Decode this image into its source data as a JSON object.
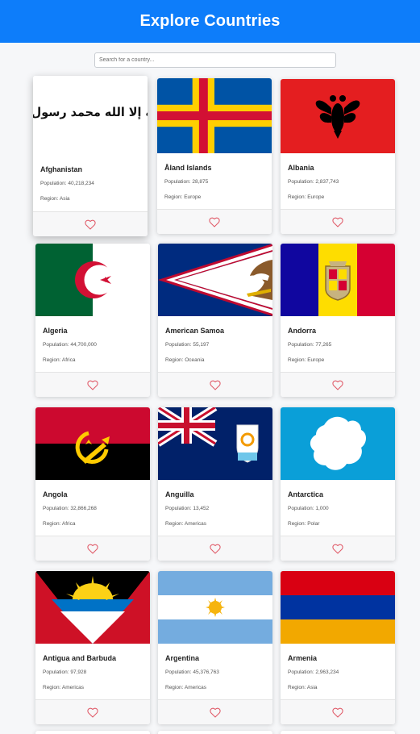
{
  "header": {
    "title": "Explore Countries"
  },
  "search": {
    "placeholder": "Search for a country...",
    "value": ""
  },
  "labels": {
    "population": "Population: ",
    "region": "Region: "
  },
  "colors": {
    "header": "#0d7dfa",
    "heart": "#e05a68"
  },
  "countries": [
    {
      "name": "Afghanistan",
      "population": "40,218,234",
      "region": "Asia",
      "flag_icon": "afghanistan-flag",
      "flag_inscription": "لا إله إلا الله محمد رسول الله"
    },
    {
      "name": "Åland Islands",
      "population": "28,875",
      "region": "Europe",
      "flag_icon": "aland-islands-flag"
    },
    {
      "name": "Albania",
      "population": "2,837,743",
      "region": "Europe",
      "flag_icon": "albania-flag"
    },
    {
      "name": "Algeria",
      "population": "44,700,000",
      "region": "Africa",
      "flag_icon": "algeria-flag"
    },
    {
      "name": "American Samoa",
      "population": "55,197",
      "region": "Oceania",
      "flag_icon": "american-samoa-flag"
    },
    {
      "name": "Andorra",
      "population": "77,265",
      "region": "Europe",
      "flag_icon": "andorra-flag"
    },
    {
      "name": "Angola",
      "population": "32,866,268",
      "region": "Africa",
      "flag_icon": "angola-flag"
    },
    {
      "name": "Anguilla",
      "population": "13,452",
      "region": "Americas",
      "flag_icon": "anguilla-flag"
    },
    {
      "name": "Antarctica",
      "population": "1,000",
      "region": "Polar",
      "flag_icon": "antarctica-flag"
    },
    {
      "name": "Antigua and Barbuda",
      "population": "97,928",
      "region": "Americas",
      "flag_icon": "antigua-and-barbuda-flag"
    },
    {
      "name": "Argentina",
      "population": "45,376,763",
      "region": "Americas",
      "flag_icon": "argentina-flag"
    },
    {
      "name": "Armenia",
      "population": "2,963,234",
      "region": "Asia",
      "flag_icon": "armenia-flag"
    }
  ]
}
